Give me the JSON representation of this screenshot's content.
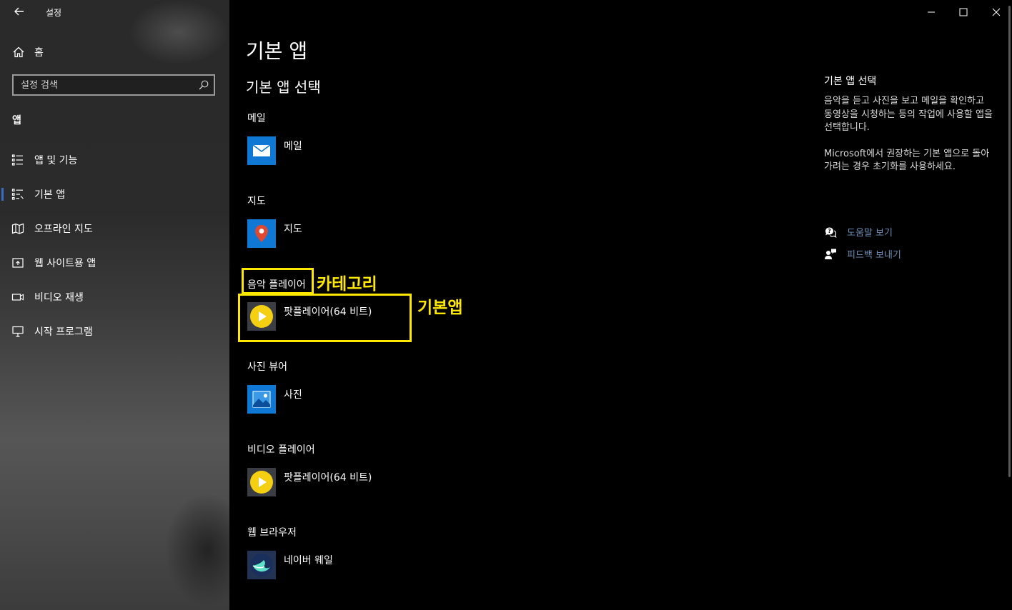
{
  "window": {
    "title": "설정"
  },
  "sidebar": {
    "home_label": "홈",
    "search_placeholder": "설정 검색",
    "section_heading": "앱",
    "items": [
      {
        "label": "앱 및 기능",
        "icon": "list-icon"
      },
      {
        "label": "기본 앱",
        "icon": "default-apps-icon",
        "selected": true
      },
      {
        "label": "오프라인 지도",
        "icon": "map-icon"
      },
      {
        "label": "웹 사이트용 앱",
        "icon": "web-app-icon"
      },
      {
        "label": "비디오 재생",
        "icon": "video-icon"
      },
      {
        "label": "시작 프로그램",
        "icon": "startup-icon"
      }
    ]
  },
  "main": {
    "page_title": "기본 앱",
    "section_title": "기본 앱 선택",
    "categories": [
      {
        "label": "메일",
        "app": "메일",
        "icon": "mail-app-icon"
      },
      {
        "label": "지도",
        "app": "지도",
        "icon": "maps-app-icon"
      },
      {
        "label": "음악 플레이어",
        "app": "팟플레이어(64 비트)",
        "icon": "potplayer-icon"
      },
      {
        "label": "사진 뷰어",
        "app": "사진",
        "icon": "photos-app-icon"
      },
      {
        "label": "비디오 플레이어",
        "app": "팟플레이어(64 비트)",
        "icon": "potplayer-icon"
      },
      {
        "label": "웹 브라우저",
        "app": "네이버 웨일",
        "icon": "whale-browser-icon"
      }
    ]
  },
  "info_panel": {
    "title": "기본 앱 선택",
    "paragraph1": "음악을 듣고 사진을 보고 메일을 확인하고 동영상을 시청하는 등의 작업에 사용할 앱을 선택합니다.",
    "paragraph2": "Microsoft에서 권장하는 기본 앱으로 돌아가려는 경우 초기화를 사용하세요.",
    "help_link": "도움말 보기",
    "feedback_link": "피드백 보내기"
  },
  "annotations": {
    "category_label": "카테고리",
    "default_app_label": "기본앱"
  },
  "colors": {
    "highlight": "#ffe800",
    "link": "#6b8fb8",
    "tile_blue": "#0f78d4",
    "potplayer_yellow": "#f4cf12"
  }
}
